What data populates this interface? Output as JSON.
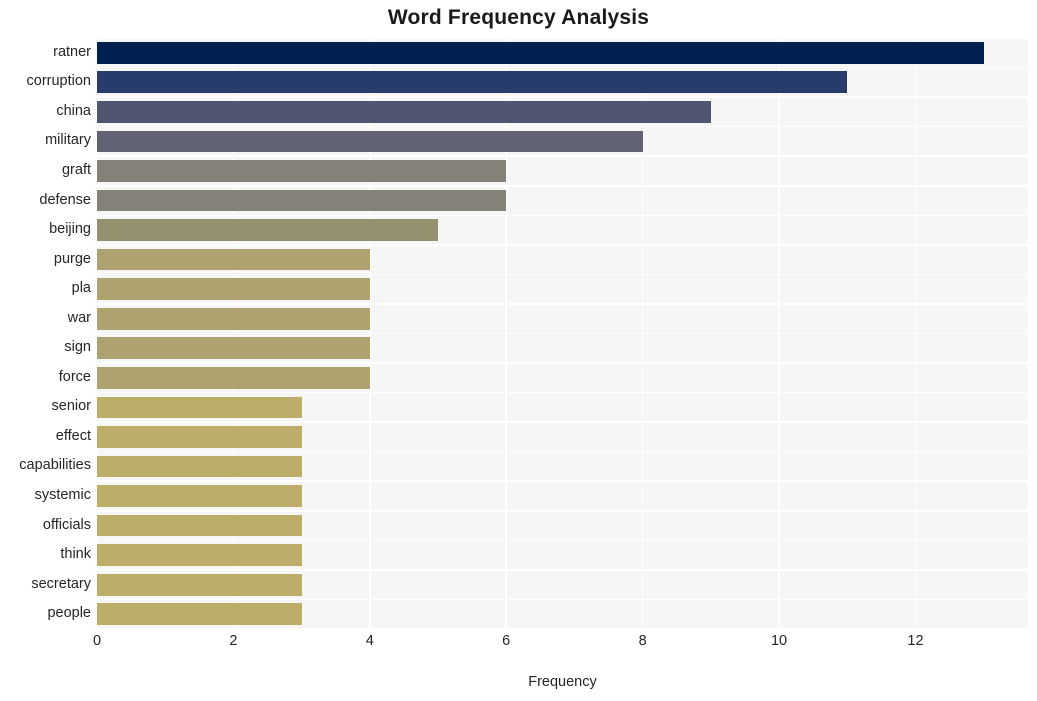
{
  "chart_data": {
    "type": "bar",
    "orientation": "horizontal",
    "title": "Word Frequency Analysis",
    "xlabel": "Frequency",
    "ylabel": "",
    "categories": [
      "ratner",
      "corruption",
      "china",
      "military",
      "graft",
      "defense",
      "beijing",
      "purge",
      "pla",
      "war",
      "sign",
      "force",
      "senior",
      "effect",
      "capabilities",
      "systemic",
      "officials",
      "think",
      "secretary",
      "people"
    ],
    "values": [
      13,
      11,
      9,
      8,
      6,
      6,
      5,
      4,
      4,
      4,
      4,
      4,
      3,
      3,
      3,
      3,
      3,
      3,
      3,
      3
    ],
    "bar_colors": [
      "#002050",
      "#273c6b",
      "#505570",
      "#616375",
      "#838178",
      "#838178",
      "#94916f",
      "#afa271",
      "#afa271",
      "#afa271",
      "#afa271",
      "#afa271",
      "#bcae68",
      "#bcae68",
      "#bcae68",
      "#bcae68",
      "#bcae68",
      "#bcae68",
      "#bcae68",
      "#bcae68"
    ],
    "xlim": [
      0,
      13.65
    ],
    "xticks": [
      0,
      2,
      4,
      6,
      8,
      10,
      12
    ],
    "xtick_labels": [
      "0",
      "2",
      "4",
      "6",
      "8",
      "10",
      "12"
    ],
    "grid": true,
    "grid_color": "#ffffff",
    "plot_background": "#f6f6f7",
    "figure_background": "#ffffff",
    "legend": null
  }
}
